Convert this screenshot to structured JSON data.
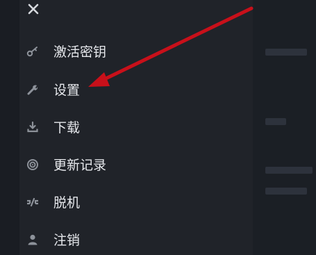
{
  "menu": {
    "close_icon": "close-icon",
    "items": [
      {
        "id": "activate-key",
        "label": "激活密钥",
        "icon": "key-icon"
      },
      {
        "id": "settings",
        "label": "设置",
        "icon": "wrench-icon"
      },
      {
        "id": "download",
        "label": "下载",
        "icon": "download-icon"
      },
      {
        "id": "changelog",
        "label": "更新记录",
        "icon": "changelog-icon"
      },
      {
        "id": "offline",
        "label": "脱机",
        "icon": "offline-icon"
      },
      {
        "id": "logout",
        "label": "注销",
        "icon": "user-icon"
      }
    ]
  },
  "annotation": {
    "arrow_color": "#c8101a"
  },
  "colors": {
    "panel_bg": "#202329",
    "text": "#e6e8ec",
    "icon": "#8d929a"
  }
}
